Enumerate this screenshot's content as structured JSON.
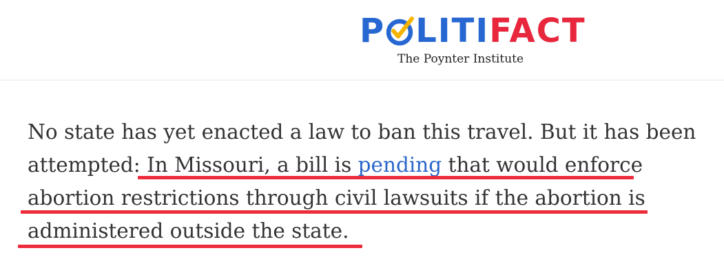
{
  "header": {
    "logo": {
      "part_blue_1": "P",
      "part_blue_2": "LITI",
      "part_red": "FACT",
      "checkmark_icon": "check-circle-icon",
      "colors": {
        "blue": "#2767d1",
        "red": "#e8263c",
        "check": "#f5b400"
      }
    },
    "tagline": "The Poynter Institute"
  },
  "article": {
    "line1": "No state has yet enacted a law to ban this travel. But it has been",
    "line2_before": "attempted: In Missouri, a bill is ",
    "line2_link": "pending",
    "line2_after": " that would enforce",
    "line3": "abortion restrictions through civil lawsuits if the abortion is",
    "line4": "administered outside the state.",
    "link_color": "#2a66c9",
    "highlight_color": "#ee2b3b"
  }
}
